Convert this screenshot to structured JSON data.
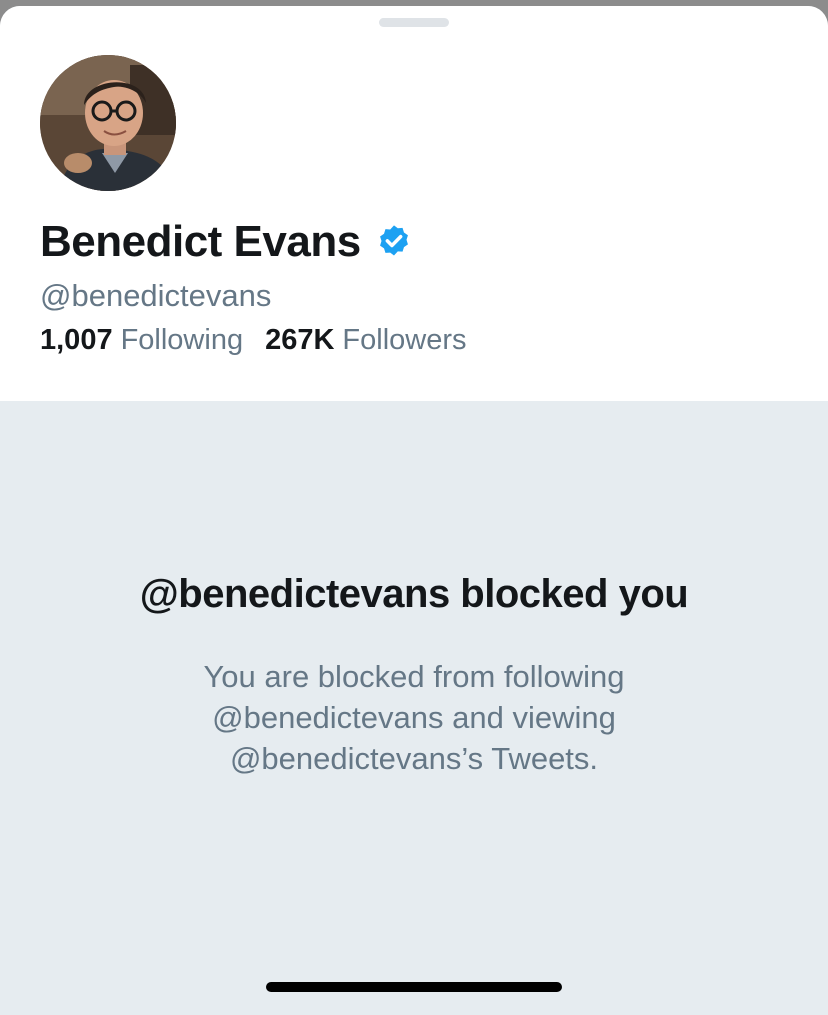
{
  "profile": {
    "display_name": "Benedict Evans",
    "verified": true,
    "handle": "@benedictevans",
    "avatar_icon": "profile-photo",
    "following_count": "1,007",
    "following_label": "Following",
    "followers_count": "267K",
    "followers_label": "Followers"
  },
  "blocked": {
    "title": "@benedictevans blocked you",
    "message": "You are blocked from following @benedictevans and viewing @benedictevans’s Tweets."
  },
  "colors": {
    "verified_blue": "#1da1f2",
    "secondary_text": "#657786",
    "primary_text": "#14171a",
    "background_gray": "#e6ecf0"
  }
}
